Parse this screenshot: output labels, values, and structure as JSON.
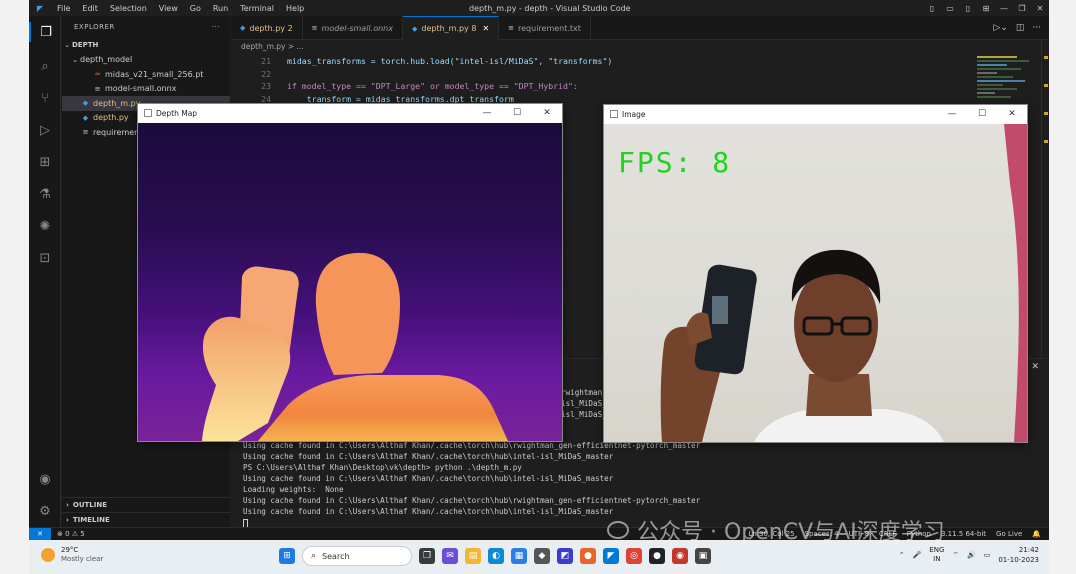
{
  "titlebar": {
    "menu": [
      "File",
      "Edit",
      "Selection",
      "View",
      "Go",
      "Run",
      "Terminal",
      "Help"
    ],
    "window_title": "depth_m.py - depth - Visual Studio Code"
  },
  "explorer": {
    "header": "EXPLORER",
    "root": "DEPTH",
    "items": [
      {
        "label": "depth_model",
        "kind": "folder"
      },
      {
        "label": "midas_v21_small_256.pt",
        "kind": "file"
      },
      {
        "label": "model-small.onnx",
        "kind": "file"
      },
      {
        "label": "depth_m.py",
        "kind": "py",
        "selected": true
      },
      {
        "label": "depth.py",
        "kind": "py"
      },
      {
        "label": "requirement.txt",
        "kind": "file"
      }
    ],
    "outline": "OUTLINE",
    "timeline": "TIMELINE"
  },
  "tabs": [
    {
      "label": "depth.py 2",
      "active": false
    },
    {
      "label": "model-small.onnx",
      "active": false
    },
    {
      "label": "depth_m.py 8",
      "active": true
    },
    {
      "label": "requirement.txt",
      "active": false
    }
  ],
  "breadcrumb": "depth_m.py > ...",
  "editor": {
    "lines": [
      {
        "n": "21",
        "text": "midas_transforms = torch.hub.load(\"intel-isl/MiDaS\", \"transforms\")"
      },
      {
        "n": "22",
        "text": ""
      },
      {
        "n": "23",
        "text": "if model_type == \"DPT_Large\" or model_type == \"DPT_Hybrid\":"
      },
      {
        "n": "24",
        "text": "    transform = midas_transforms.dpt_transform"
      }
    ]
  },
  "terminal": {
    "top_lines": [
      "rwightman_gen-eff",
      "isl_MiDaS_master",
      "isl_MiDaS_master"
    ],
    "lines": [
      "Using cache found in C:\\Users\\Althaf Khan/.cache\\torch\\hub\\rwightman_gen-efficientnet-pytorch_master",
      "Using cache found in C:\\Users\\Althaf Khan/.cache\\torch\\hub\\intel-isl_MiDaS_master",
      "PS C:\\Users\\Althaf Khan\\Desktop\\vk\\depth> python .\\depth_m.py",
      "Using cache found in C:\\Users\\Althaf Khan/.cache\\torch\\hub\\intel-isl_MiDaS_master",
      "Loading weights:  None",
      "Using cache found in C:\\Users\\Althaf Khan/.cache\\torch\\hub\\rwightman_gen-efficientnet-pytorch_master",
      "Using cache found in C:\\Users\\Althaf Khan/.cache\\torch\\hub\\intel-isl_MiDaS_master"
    ]
  },
  "statusbar": {
    "problems": "⊗ 0 ⚠ 5",
    "position": "Ln 30, Col 25",
    "spaces": "Spaces: 4",
    "encoding": "UTF-8",
    "eol": "CRLF",
    "language": "Python",
    "version": "3.11.5 64-bit",
    "golive": "Go Live"
  },
  "depth_window": {
    "title": "Depth Map"
  },
  "image_window": {
    "title": "Image",
    "fps_text": "FPS: 8"
  },
  "taskbar": {
    "temperature": "29°C",
    "weather": "Mostly clear",
    "search_placeholder": "Search",
    "lang_top": "ENG",
    "lang_bottom": "IN",
    "time": "21:42",
    "date": "01-10-2023"
  },
  "watermark": "公众号 · OpenCV与AI深度学习",
  "colors": {
    "accent": "#0078d4",
    "fps_green": "#1fd31f"
  }
}
